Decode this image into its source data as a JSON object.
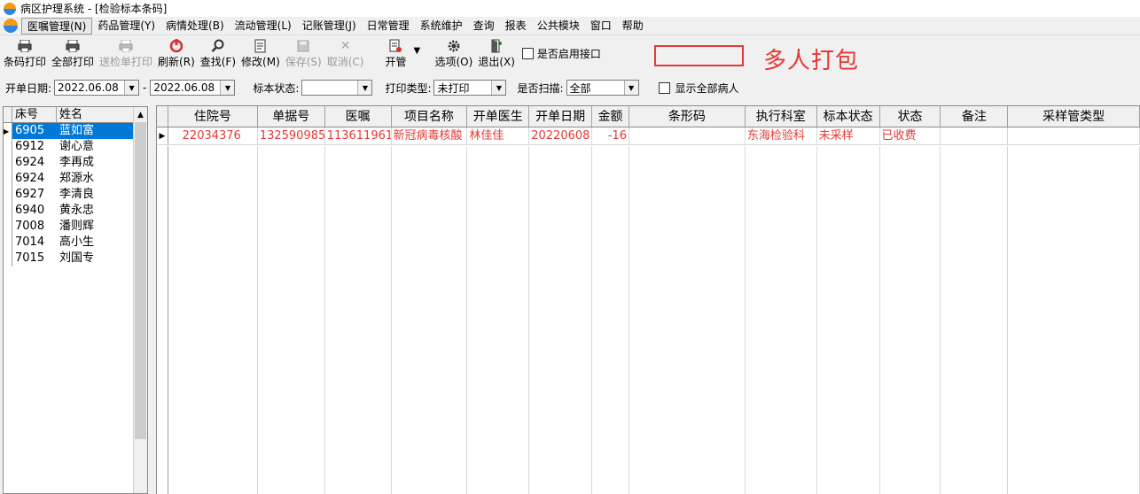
{
  "window": {
    "title": "病区护理系统 - [检验标本条码]"
  },
  "menu": [
    "医嘱管理(N)",
    "药品管理(Y)",
    "病情处理(B)",
    "流动管理(L)",
    "记账管理(J)",
    "日常管理",
    "系统维护",
    "查询",
    "报表",
    "公共模块",
    "窗口",
    "帮助"
  ],
  "toolbar": {
    "barcode_print": "条码打印",
    "print_all": "全部打印",
    "print_lab_sheet": "送检单打印",
    "refresh": "刷新(R)",
    "find": "查找(F)",
    "modify": "修改(M)",
    "save": "保存(S)",
    "cancel": "取消(C)",
    "open_tube": "开管",
    "options": "选项(O)",
    "exit": "退出(X)",
    "enable_interface": "是否启用接口"
  },
  "annotation": {
    "text": "多人打包",
    "color": "#e53935"
  },
  "filters": {
    "open_date_label": "开单日期:",
    "date_from": "2022.06.08",
    "date_sep": "-",
    "date_to": "2022.06.08",
    "sample_status_label": "标本状态:",
    "sample_status": "",
    "print_type_label": "打印类型:",
    "print_type": "未打印",
    "scan_label": "是否扫描:",
    "scan": "全部",
    "show_all_label": "显示全部病人"
  },
  "patients": {
    "headers": {
      "bed": "床号",
      "name": "姓名"
    },
    "rows": [
      {
        "bed": "6905",
        "name": "蓝如富"
      },
      {
        "bed": "6912",
        "name": "谢心意"
      },
      {
        "bed": "6924",
        "name": "李再成"
      },
      {
        "bed": "6924",
        "name": "郑源水"
      },
      {
        "bed": "6927",
        "name": "李清良"
      },
      {
        "bed": "6940",
        "name": "黄永忠"
      },
      {
        "bed": "7008",
        "name": "潘则辉"
      },
      {
        "bed": "7014",
        "name": "高小生"
      },
      {
        "bed": "7015",
        "name": "刘国专"
      }
    ]
  },
  "grid": {
    "headers": [
      "住院号",
      "单据号",
      "医嘱",
      "项目名称",
      "开单医生",
      "开单日期",
      "金额",
      "条形码",
      "执行科室",
      "标本状态",
      "状态",
      "备注",
      "采样管类型"
    ],
    "rows": [
      [
        "22034376",
        "132590985",
        "113611961",
        "新冠病毒核酸",
        "林佳佳",
        "20220608",
        "-16",
        "",
        "东海检验科",
        "未采样",
        "已收费",
        "",
        ""
      ]
    ]
  },
  "colors": {
    "selection": "#0078d7",
    "row_text": "#e53935"
  }
}
